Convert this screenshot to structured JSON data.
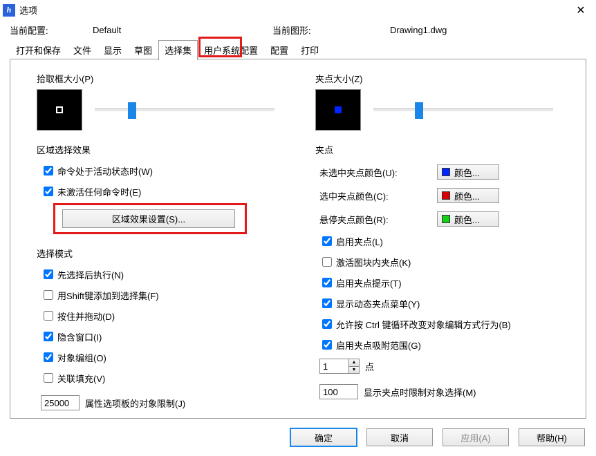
{
  "window": {
    "title": "选项"
  },
  "header": {
    "config_label": "当前配置:",
    "config_value": "Default",
    "drawing_label": "当前图形:",
    "drawing_value": "Drawing1.dwg"
  },
  "tabs": {
    "open_save": "打开和保存",
    "file": "文件",
    "display": "显示",
    "sketch": "草图",
    "selection": "选择集",
    "user_sys": "用户系统配置",
    "config": "配置",
    "print": "打印",
    "active": "selection"
  },
  "left": {
    "pickbox_label": "拾取框大小(P)",
    "area_effect_label": "区域选择效果",
    "cmd_active": {
      "label": "命令处于活动状态时(W)",
      "checked": true
    },
    "no_cmd_active": {
      "label": "未激活任何命令时(E)",
      "checked": true
    },
    "area_settings_btn": "区域效果设置(S)...",
    "select_mode_label": "选择模式",
    "noun_verb": {
      "label": "先选择后执行(N)",
      "checked": true
    },
    "use_shift": {
      "label": "用Shift键添加到选择集(F)",
      "checked": false
    },
    "press_drag": {
      "label": "按住并拖动(D)",
      "checked": false
    },
    "implied_window": {
      "label": "隐含窗口(I)",
      "checked": true
    },
    "object_group": {
      "label": "对象编组(O)",
      "checked": true
    },
    "assoc_hatch": {
      "label": "关联填充(V)",
      "checked": false
    },
    "obj_limit_value": "25000",
    "obj_limit_label": "属性选项板的对象限制(J)"
  },
  "right": {
    "grip_label": "夹点大小(Z)",
    "grips_section": "夹点",
    "unsel_color": {
      "label": "未选中夹点颜色(U):",
      "color": "#0026ff",
      "text": "颜色..."
    },
    "sel_color": {
      "label": "选中夹点颜色(C):",
      "color": "#d80000",
      "text": "颜色..."
    },
    "hover_color": {
      "label": "悬停夹点颜色(R):",
      "color": "#15d015",
      "text": "颜色..."
    },
    "enable_grips": {
      "label": "启用夹点(L)",
      "checked": true
    },
    "blk_grips": {
      "label": "激活图块内夹点(K)",
      "checked": false
    },
    "grip_tips": {
      "label": "启用夹点提示(T)",
      "checked": true
    },
    "dyn_menu": {
      "label": "显示动态夹点菜单(Y)",
      "checked": true
    },
    "ctrl_cycle": {
      "label": "允许按 Ctrl 键循环改变对象编辑方式行为(B)",
      "checked": true
    },
    "snap_range": {
      "label": "启用夹点吸附范围(G)",
      "checked": true
    },
    "snap_value": "1",
    "snap_unit": "点",
    "limit_value": "100",
    "limit_label": "显示夹点时限制对象选择(M)"
  },
  "buttons": {
    "ok": "确定",
    "cancel": "取消",
    "apply": "应用(A)",
    "help": "帮助(H)"
  }
}
